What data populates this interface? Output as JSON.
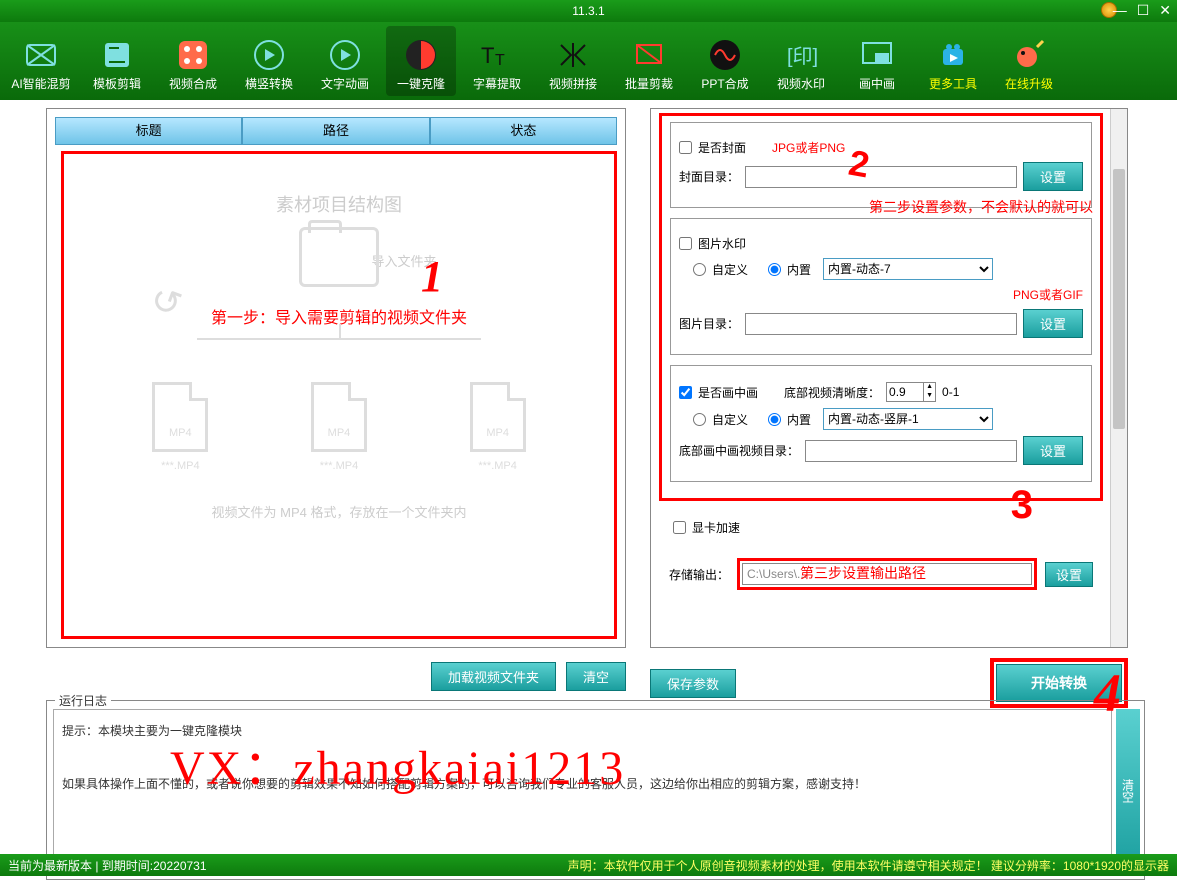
{
  "title": "11.3.1",
  "toolbar": [
    {
      "label": "AI智能混剪"
    },
    {
      "label": "模板剪辑"
    },
    {
      "label": "视频合成"
    },
    {
      "label": "横竖转换"
    },
    {
      "label": "文字动画"
    },
    {
      "label": "一键克隆"
    },
    {
      "label": "字幕提取"
    },
    {
      "label": "视频拼接"
    },
    {
      "label": "批量剪裁"
    },
    {
      "label": "PPT合成"
    },
    {
      "label": "视频水印"
    },
    {
      "label": "画中画"
    },
    {
      "label": "更多工具"
    },
    {
      "label": "在线升级"
    }
  ],
  "active_tool_index": 5,
  "table_headers": [
    "标题",
    "路径",
    "状态"
  ],
  "diagram": {
    "title": "素材项目结构图",
    "import_label": "导入文件夹",
    "step1": "第一步：导入需要剪辑的视频文件夹",
    "mp4_label": "MP4",
    "fn": "***.MP4",
    "note": "视频文件为 MP4 格式，存放在一个文件夹内"
  },
  "buttons": {
    "load_folder": "加载视频文件夹",
    "clear": "清空",
    "save_params": "保存参数",
    "start": "开始转换",
    "set": "设置",
    "log_clear": "清空"
  },
  "settings": {
    "cover": {
      "chk": "是否封面",
      "hint": "JPG或者PNG",
      "dir_label": "封面目录：",
      "dir_value": ""
    },
    "step2_note": "第二步设置参数，不会默认的就可以",
    "watermark": {
      "chk": "图片水印",
      "custom": "自定义",
      "builtin": "内置",
      "builtin_value": "内置-动态-7",
      "hint": "PNG或者GIF",
      "dir_label": "图片目录：",
      "dir_value": ""
    },
    "pip": {
      "chk": "是否画中画",
      "clarity_label": "底部视频清晰度：",
      "clarity_value": "0.9",
      "range": "0-1",
      "custom": "自定义",
      "builtin": "内置",
      "builtin_value": "内置-动态-竖屏-1",
      "dir_label": "底部画中画视频目录：",
      "dir_value": ""
    },
    "gpu": "显卡加速",
    "output_label": "存储输出：",
    "output_value": "C:\\Users\\...",
    "output_note": "第三步设置输出路径"
  },
  "log": {
    "title": "运行日志",
    "line1": "提示：本模块主要为一键克隆模块",
    "line2": "如果具体操作上面不懂的，或者说你想要的剪辑效果不知如何搭配剪辑方案的，可以咨询我们专业的客服人员，这边给你出相应的剪辑方案，感谢支持！"
  },
  "annotations": {
    "a1": "1",
    "a2": "2",
    "a3": "3",
    "a4": "4",
    "vx": "VX：zhangkaiai1213"
  },
  "statusbar": {
    "left": "当前为最新版本 | 到期时间:20220731",
    "right": "声明：本软件仅用于个人原创音视频素材的处理，使用本软件请遵守相关规定！  建议分辨率：1080*1920的显示器"
  }
}
